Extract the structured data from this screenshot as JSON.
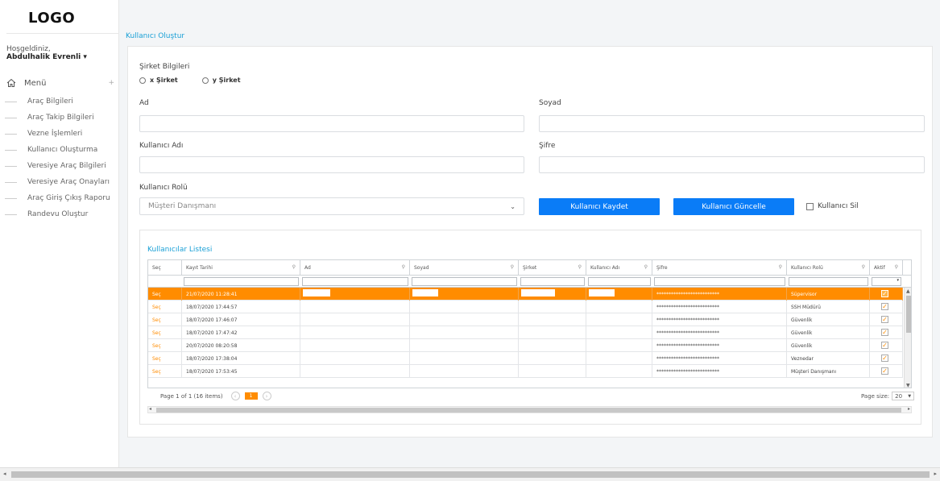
{
  "sidebar": {
    "logo": "LOGO",
    "welcome": "Hoşgeldiniz,",
    "username": "Abdulhalik Evrenli ▾",
    "menu_label": "Menü",
    "menu_toggle": "+",
    "items": [
      {
        "label": "Araç Bilgileri"
      },
      {
        "label": "Araç Takip Bilgileri"
      },
      {
        "label": "Vezne İşlemleri"
      },
      {
        "label": "Kullanıcı Oluşturma"
      },
      {
        "label": "Veresiye Araç Bilgileri"
      },
      {
        "label": "Veresiye Araç Onayları"
      },
      {
        "label": "Araç Giriş Çıkış Raporu"
      },
      {
        "label": "Randevu Oluştur"
      }
    ]
  },
  "page": {
    "title": "Kullanıcı Oluştur"
  },
  "form": {
    "company_label": "Şirket Bilgileri",
    "company_options": [
      "x Şirket",
      "y Şirket"
    ],
    "first_name_label": "Ad",
    "first_name_value": "",
    "last_name_label": "Soyad",
    "last_name_value": "",
    "username_label": "Kullanıcı Adı",
    "username_value": "",
    "password_label": "Şifre",
    "password_value": "",
    "role_label": "Kullanıcı Rolü",
    "role_selected": "Müşteri Danışmanı",
    "save_button": "Kullanıcı Kaydet",
    "update_button": "Kullanıcı Güncelle",
    "delete_checkbox": "Kullanıcı Sil"
  },
  "list": {
    "title": "Kullanıcılar Listesi",
    "columns": [
      "Seç",
      "Kayıt Tarihi",
      "Ad",
      "Soyad",
      "Şirket",
      "Kullanıcı Adı",
      "Şifre",
      "Kullanıcı Rolü",
      "Aktif"
    ],
    "select_link": "Seç",
    "rows": [
      {
        "date": "21/07/2020 11:28:41",
        "password": "**************************",
        "role": "Süpervisor",
        "active": true,
        "selected": true
      },
      {
        "date": "18/07/2020 17:44:57",
        "password": "**************************",
        "role": "SSH Müdürü",
        "active": true,
        "selected": false
      },
      {
        "date": "18/07/2020 17:46:07",
        "password": "**************************",
        "role": "Güvenlik",
        "active": true,
        "selected": false
      },
      {
        "date": "18/07/2020 17:47:42",
        "password": "**************************",
        "role": "Güvenlik",
        "active": true,
        "selected": false
      },
      {
        "date": "20/07/2020 08:20:58",
        "password": "**************************",
        "role": "Güvenlik",
        "active": true,
        "selected": false
      },
      {
        "date": "18/07/2020 17:38:04",
        "password": "**************************",
        "role": "Veznedar",
        "active": true,
        "selected": false
      },
      {
        "date": "18/07/2020 17:53:45",
        "password": "**************************",
        "role": "Müşteri Danışmanı",
        "active": true,
        "selected": false
      }
    ],
    "pager_info": "Page 1 of 1 (16 items)",
    "current_page": "1",
    "page_size_label": "Page size:",
    "page_size": "20"
  },
  "colors": {
    "accent_blue": "#0a7cf7",
    "title_blue": "#1aa0d6",
    "selected_orange": "#ff8c00"
  }
}
